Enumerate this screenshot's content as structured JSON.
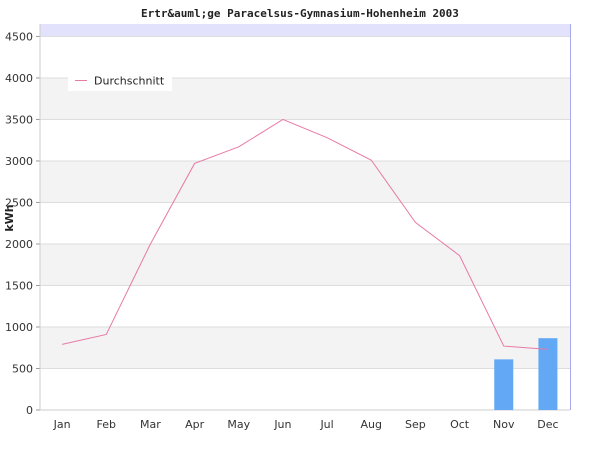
{
  "chart_data": {
    "type": "bar",
    "title": "Ertr&auml;ge Paracelsus-Gymnasium-Hohenheim 2003",
    "xlabel": "",
    "ylabel": "kWh",
    "categories": [
      "Jan",
      "Feb",
      "Mar",
      "Apr",
      "May",
      "Jun",
      "Jul",
      "Aug",
      "Sep",
      "Oct",
      "Nov",
      "Dec"
    ],
    "ylim": [
      0,
      4650
    ],
    "yticks": [
      0,
      500,
      1000,
      1500,
      2000,
      2500,
      3000,
      3500,
      4000,
      4500
    ],
    "grid": true,
    "legend_position": "top-left",
    "series": [
      {
        "type": "bar",
        "values": [
          null,
          null,
          null,
          null,
          null,
          null,
          null,
          null,
          null,
          null,
          610,
          865
        ],
        "color": "#63a8f4"
      },
      {
        "type": "line",
        "name": "Durchschnitt",
        "values": [
          790,
          910,
          2000,
          2970,
          3170,
          3500,
          3280,
          3010,
          2260,
          1860,
          770,
          730
        ],
        "color": "#e87aa6"
      }
    ]
  }
}
